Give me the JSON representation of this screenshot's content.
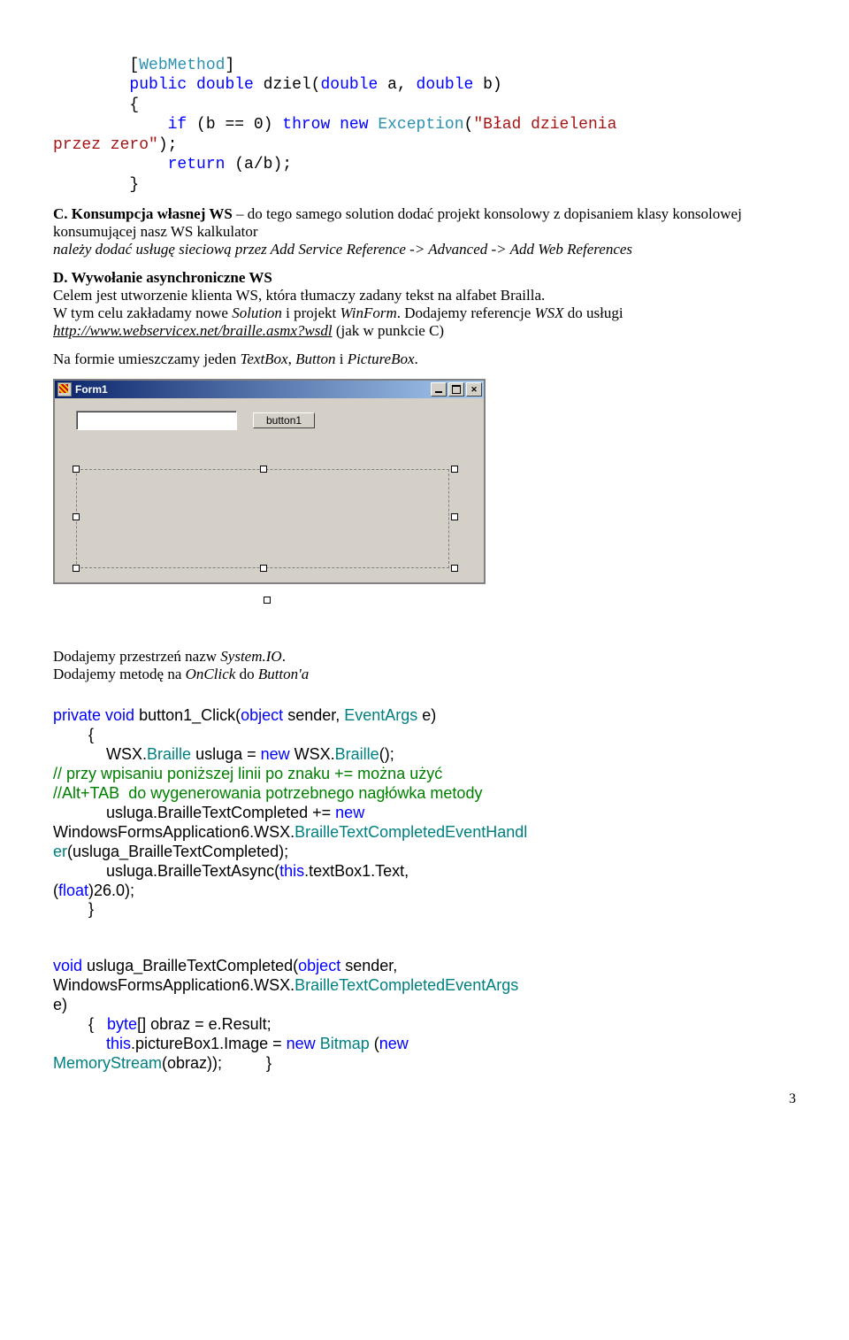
{
  "code1": {
    "l1_sb": "        [",
    "l1_wm": "WebMethod",
    "l1_eb": "]",
    "l2a": "        ",
    "l2_public": "public",
    "l2_sp": " ",
    "l2_double1": "double",
    "l2_name": " dziel(",
    "l2_double2": "double",
    "l2_mid": " a, ",
    "l2_double3": "double",
    "l2_end": " b)",
    "l3": "        {",
    "l4a": "            ",
    "l4_if": "if",
    "l4_mid": " (b == 0) ",
    "l4_throw": "throw",
    "l4_sp": " ",
    "l4_new": "new",
    "l4_sp2": " ",
    "l4_exc": "Exception",
    "l4_paren": "(",
    "l4_str": "\"Bład dzielenia\nprzez zero\"",
    "l4_end": ");",
    "l5a": "            ",
    "l5_return": "return",
    "l5_end": " (a/b);",
    "l6": "        }"
  },
  "paraC": {
    "prefix": "C. Konsumpcja własnej WS",
    "rest1": " – do tego samego solution dodać projekt konsolowy z dopisaniem klasy konsolowej konsumującej nasz WS kalkulator",
    "rest2_italic": "należy dodać usługę sieciową przez Add Service Reference -> Advanced -> Add Web References"
  },
  "paraD": {
    "heading": "D. Wywołanie asynchroniczne WS",
    "line1": "Celem jest utworzenie klienta WS, która tłumaczy zadany tekst na alfabet Brailla.",
    "line2a": "W tym celu zakładamy nowe ",
    "line2b_it": "Solution",
    "line2c": " i projekt ",
    "line2d_it": "WinForm",
    "line2e": ". Dodajemy referencje ",
    "line2f_it": "WSX",
    "line2g": " do usługi ",
    "link": "http://www.webservicex.net/braille.asmx?wsdl",
    "line2h": " (jak w punkcie C)",
    "line3a": "Na formie umieszczamy jeden ",
    "line3b_it": "TextBox",
    "line3c": ", ",
    "line3d_it": "Button",
    "line3e": " i ",
    "line3f_it": "PictureBox",
    "line3g": "."
  },
  "form": {
    "title": "Form1",
    "button": "button1"
  },
  "paraE": {
    "l1a": "Dodajemy przestrzeń nazw ",
    "l1b_it": "System.IO",
    "l1c": ".",
    "l2a": "Dodajemy metodę na ",
    "l2b_it": "OnClick",
    "l2c": " do ",
    "l2d_it": "Button'a"
  },
  "code2": {
    "l1_private": "private",
    "l1_sp": " ",
    "l1_void": "void",
    "l1_name": " button1_Click(",
    "l1_object": "object",
    "l1_mid": " sender, ",
    "l1_ea": "EventArgs",
    "l1_end": " e)",
    "l2": "        {",
    "l3a": "            WSX.",
    "l3_braille1": "Braille",
    "l3_mid": " usluga = ",
    "l3_new": "new",
    "l3_mid2": " WSX.",
    "l3_braille2": "Braille",
    "l3_end": "();",
    "c1": "// przy wpisaniu poniższej linii po znaku += można użyć",
    "c2": "//Alt+TAB  do wygenerowania potrzebnego nagłówka metody",
    "l4a": "            usluga.BrailleTextCompleted += ",
    "l4_new": "new",
    "l4_sp": " ",
    "l5a": "WindowsFormsApplication6.WSX.",
    "l5_handler": "BrailleTextCompletedEventHandl\ner",
    "l5b": "(usluga_BrailleTextCompleted);",
    "l6a": "            usluga.BrailleTextAsync(",
    "l6_this": "this",
    "l6b": ".textBox1.Text,",
    "l7a": "(",
    "l7_float": "float",
    "l7b": ")26.0);",
    "l8": "        }"
  },
  "code3": {
    "l1_void": "void",
    "l1_name": " usluga_BrailleTextCompleted(",
    "l1_object": "object",
    "l1_mid": " sender,",
    "l2a": "WindowsFormsApplication6.WSX.",
    "l2_args": "BrailleTextCompletedEventArgs",
    "l3": "e)",
    "l4a": "        {   ",
    "l4_byte": "byte",
    "l4b": "[] obraz = e.Result;",
    "l5a": "            ",
    "l5_this": "this",
    "l5b": ".pictureBox1.Image = ",
    "l5_new": "new",
    "l5c": " ",
    "l5_bitmap": "Bitmap",
    "l5d": " (",
    "l5_new2": "new",
    "l6a": "MemoryStream",
    "l6b": "(obraz));          }"
  },
  "page": "3"
}
